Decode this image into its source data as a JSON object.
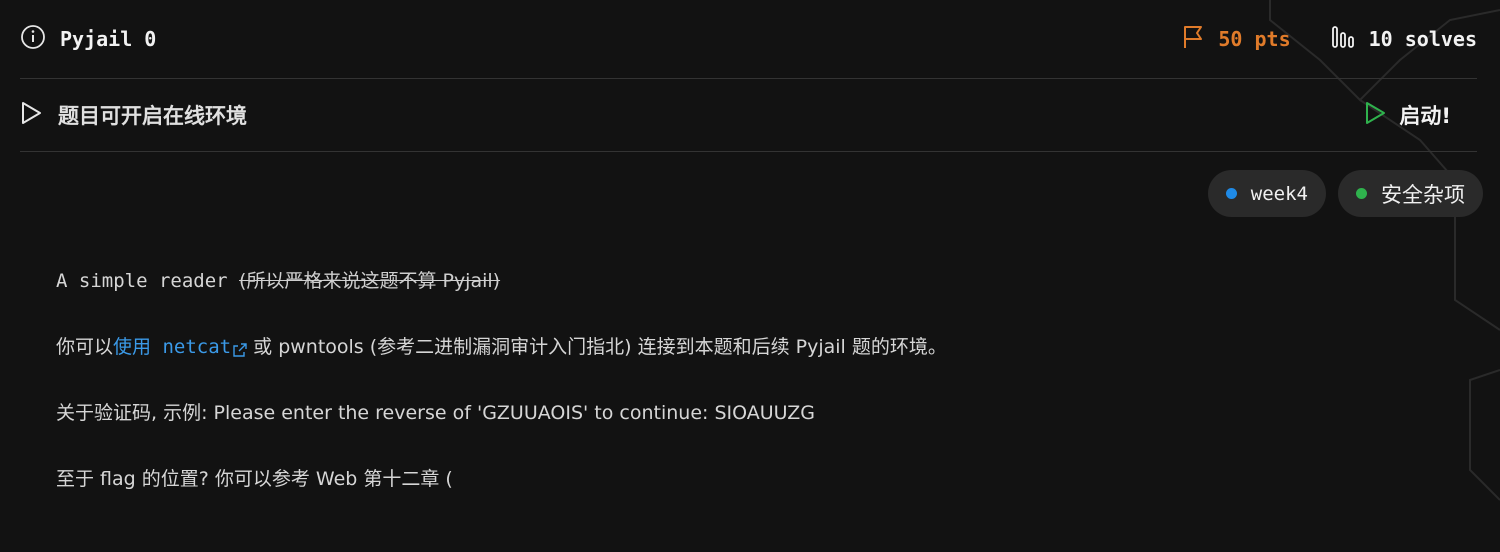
{
  "header": {
    "title": "Pyjail 0",
    "points": "50 pts",
    "solves": "10 solves"
  },
  "environment": {
    "label": "题目可开启在线环境",
    "start_label": "启动!"
  },
  "tags": [
    {
      "label": "week4",
      "color": "#1f8ae6"
    },
    {
      "label": "安全杂项",
      "color": "#2fb24d"
    }
  ],
  "description": {
    "line1_main": "A simple reader ",
    "line1_strike": "(所以严格来说这题不算 Pyjail)",
    "line2_pre": "你可以",
    "line2_link_cn": "使用",
    "line2_link_code": " netcat",
    "line2_post": " 或 pwntools (参考二进制漏洞审计入门指北) 连接到本题和后续 Pyjail 题的环境。",
    "line3": "关于验证码, 示例: Please enter the reverse of 'GZUUAOIS' to continue: SIOAUUZG",
    "line4": "至于 flag 的位置? 你可以参考 Web 第十二章 ("
  },
  "colors": {
    "background": "#121212",
    "points": "#e07b2a",
    "start": "#2fb24d",
    "link": "#3b9ae8"
  }
}
